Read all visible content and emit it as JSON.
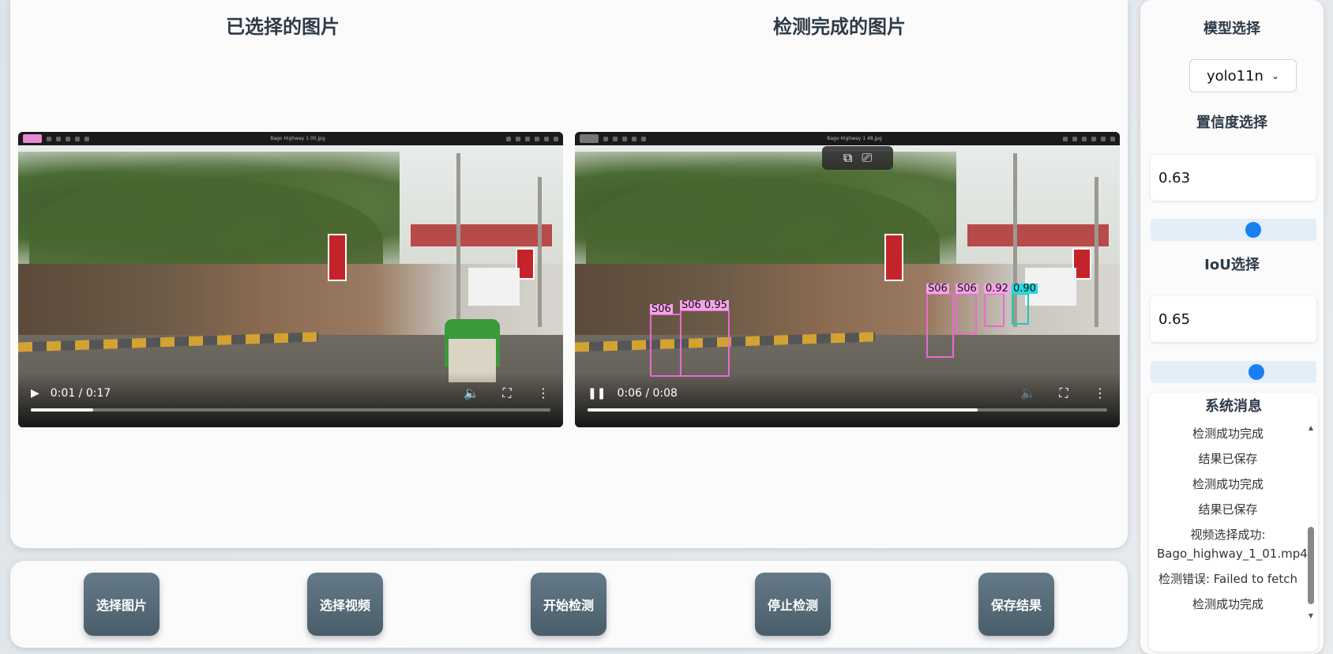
{
  "main": {
    "left_title": "已选择的图片",
    "right_title": "检测完成的图片"
  },
  "left_video": {
    "window_title": "Bago Highway 1 00.jpg",
    "time": "0:01 / 0:17",
    "progress": 0.12,
    "state": "paused"
  },
  "right_video": {
    "window_title": "Bago Highway 1 48.jpg",
    "time": "0:06 / 0:08",
    "progress": 0.75,
    "state": "playing",
    "detections": [
      "S06",
      "S06 0.95",
      "S06",
      "S06",
      "0.92",
      "0.90"
    ]
  },
  "buttons": {
    "select_image": "选择图片",
    "select_video": "选择视频",
    "start_detect": "开始检测",
    "stop_detect": "停止检测",
    "save_result": "保存结果"
  },
  "side": {
    "model_title": "模型选择",
    "model_value": "yolo11n",
    "conf_title": "置信度选择",
    "conf_value": "0.63",
    "conf_fraction": 0.63,
    "iou_title": "IoU选择",
    "iou_value": "0.65",
    "iou_fraction": 0.65,
    "msg_title": "系统消息",
    "messages": [
      "检测成功完成",
      "结果已保存",
      "检测成功完成",
      "结果已保存",
      "视频选择成功: Bago_highway_1_01.mp4",
      "检测错误: Failed to fetch",
      "检测成功完成"
    ]
  },
  "colors": {
    "button_bg": "#4a5d6b",
    "slider_thumb": "#1a7ff0",
    "detection_pink": "#e96ad0",
    "detection_cyan": "#27d7df"
  }
}
